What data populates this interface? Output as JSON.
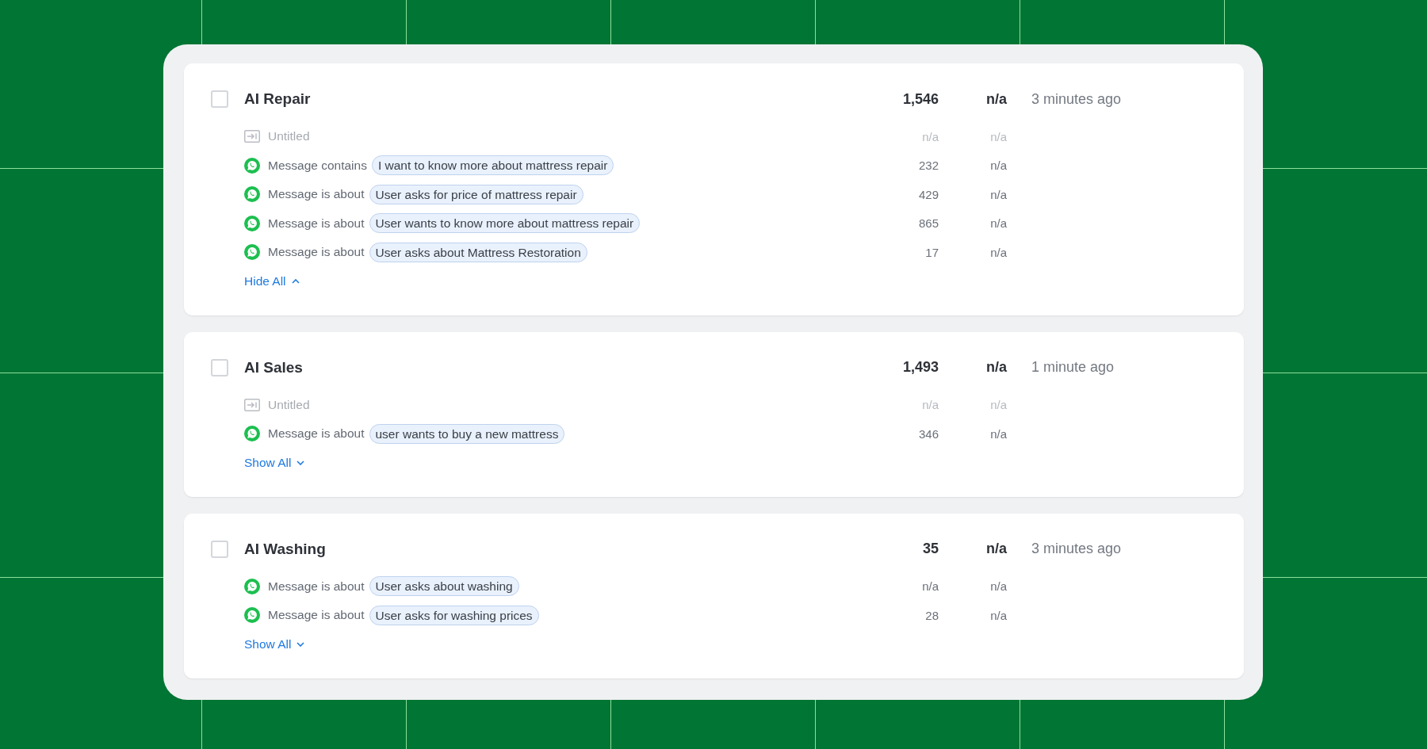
{
  "flows": [
    {
      "title": "AI Repair",
      "checked": false,
      "column_2": "1,546",
      "column_3": "n/a",
      "column_4": "3 minutes ago",
      "triggers": [
        {
          "kind": "untitled",
          "name": "Untitled",
          "column_2": "n/a",
          "column_3": "n/a"
        },
        {
          "kind": "message",
          "condition": "Message contains",
          "phrase": "I want to know more about mattress repair",
          "column_2": "232",
          "column_3": "n/a"
        },
        {
          "kind": "message",
          "condition": "Message is about",
          "phrase": "User asks for price of mattress repair",
          "column_2": "429",
          "column_3": "n/a"
        },
        {
          "kind": "message",
          "condition": "Message is about",
          "phrase": "User wants to know more about mattress repair",
          "column_2": "865",
          "column_3": "n/a"
        },
        {
          "kind": "message",
          "condition": "Message is about",
          "phrase": "User asks about Mattress Restoration",
          "column_2": "17",
          "column_3": "n/a"
        }
      ],
      "toggle": {
        "label": "Hide All",
        "expanded": true
      }
    },
    {
      "title": "AI Sales",
      "checked": false,
      "column_2": "1,493",
      "column_3": "n/a",
      "column_4": "1 minute ago",
      "triggers": [
        {
          "kind": "untitled",
          "name": "Untitled",
          "column_2": "n/a",
          "column_3": "n/a"
        },
        {
          "kind": "message",
          "condition": "Message is about",
          "phrase": "user wants to buy a new mattress",
          "column_2": "346",
          "column_3": "n/a"
        }
      ],
      "toggle": {
        "label": "Show All",
        "expanded": false
      }
    },
    {
      "title": "AI Washing",
      "checked": false,
      "column_2": "35",
      "column_3": "n/a",
      "column_4": "3 minutes ago",
      "triggers": [
        {
          "kind": "message",
          "condition": "Message is about",
          "phrase": "User asks about washing",
          "column_2": "n/a",
          "column_3": "n/a"
        },
        {
          "kind": "message",
          "condition": "Message is about",
          "phrase": "User asks for washing prices",
          "column_2": "28",
          "column_3": "n/a"
        }
      ],
      "toggle": {
        "label": "Show All",
        "expanded": false
      }
    }
  ]
}
